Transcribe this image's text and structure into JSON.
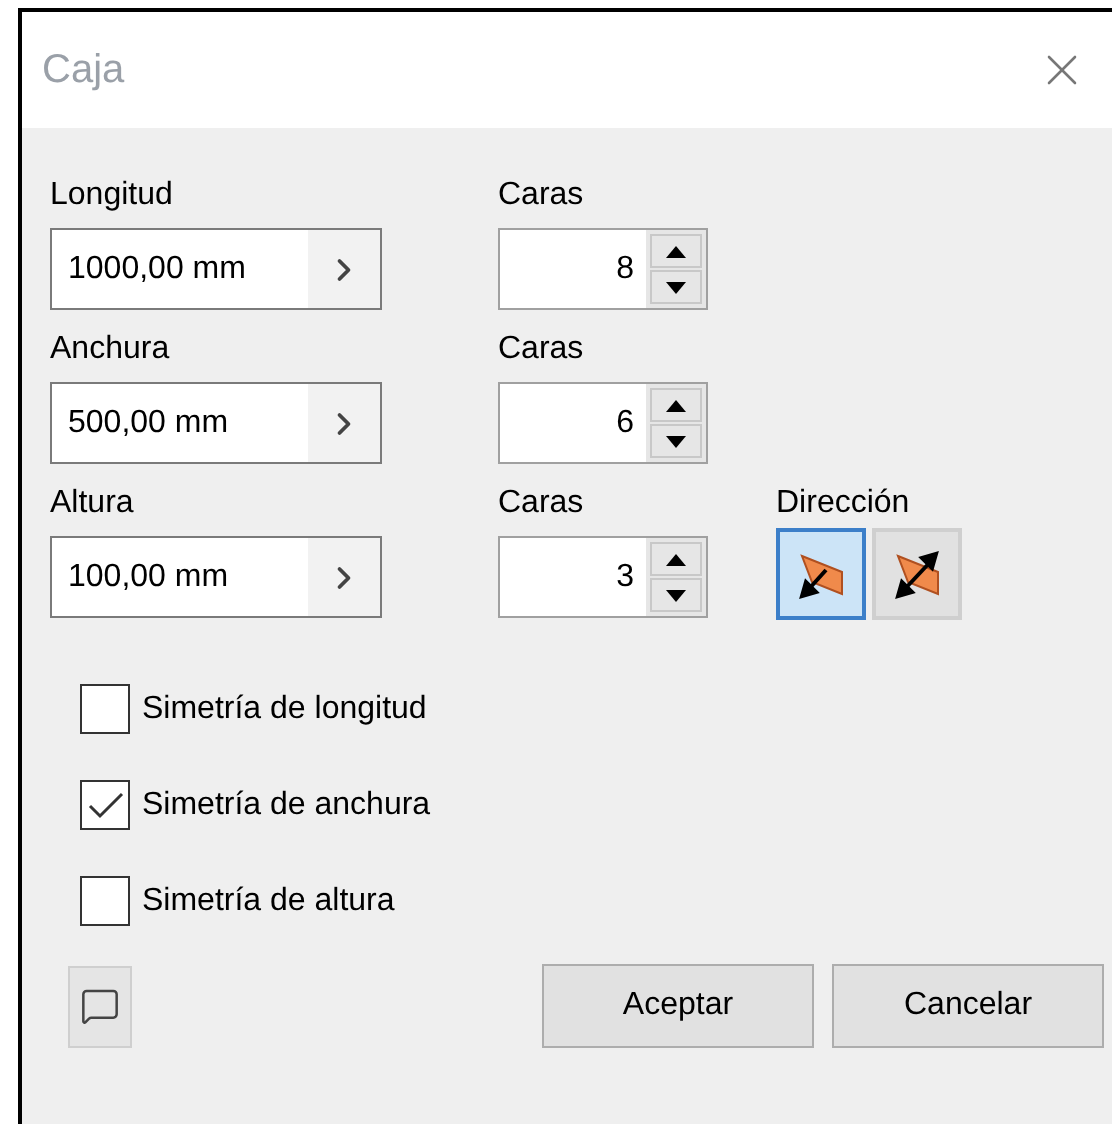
{
  "window": {
    "title": "Caja"
  },
  "rows": [
    {
      "label": "Longitud",
      "value": "1000,00 mm",
      "faces_label": "Caras",
      "faces": "8"
    },
    {
      "label": "Anchura",
      "value": "500,00 mm",
      "faces_label": "Caras",
      "faces": "6"
    },
    {
      "label": "Altura",
      "value": "100,00 mm",
      "faces_label": "Caras",
      "faces": "3"
    }
  ],
  "direction": {
    "label": "Dirección",
    "options": [
      {
        "selected": true
      },
      {
        "selected": false
      }
    ]
  },
  "checkboxes": [
    {
      "label": "Simetría de longitud",
      "checked": false
    },
    {
      "label": "Simetría de anchura",
      "checked": true
    },
    {
      "label": "Simetría de altura",
      "checked": false
    }
  ],
  "buttons": [
    "Aceptar",
    "Cancelar"
  ]
}
